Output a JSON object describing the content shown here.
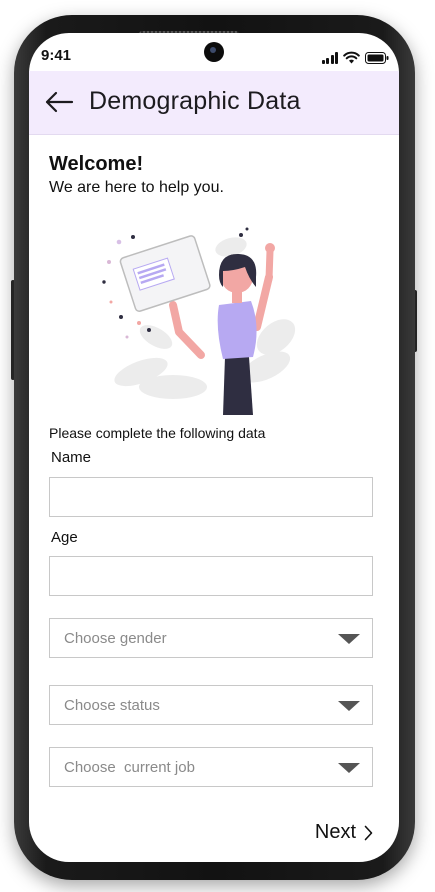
{
  "status_bar": {
    "time": "9:41"
  },
  "app_bar": {
    "title": "Demographic Data",
    "back_icon": "arrow-left-icon"
  },
  "welcome": {
    "title": "Welcome!",
    "subtitle": "We are here to help you."
  },
  "form": {
    "instruction": "Please complete the following data",
    "name": {
      "label": "Name",
      "value": "",
      "placeholder": ""
    },
    "age": {
      "label": "Age",
      "value": "",
      "placeholder": ""
    },
    "gender": {
      "placeholder": "Choose gender"
    },
    "status": {
      "placeholder": "Choose status"
    },
    "job": {
      "placeholder": "Choose  current job"
    }
  },
  "footer": {
    "next_label": "Next",
    "next_icon": "chevron-right-icon"
  },
  "colors": {
    "app_bar_bg": "#f3ebfd",
    "illustration_shirt": "#b7a9f2",
    "illustration_skin": "#f2a7a4",
    "illustration_hair": "#2f2e41",
    "input_border": "#c8c8c8",
    "placeholder_text": "#8a8a8a"
  }
}
